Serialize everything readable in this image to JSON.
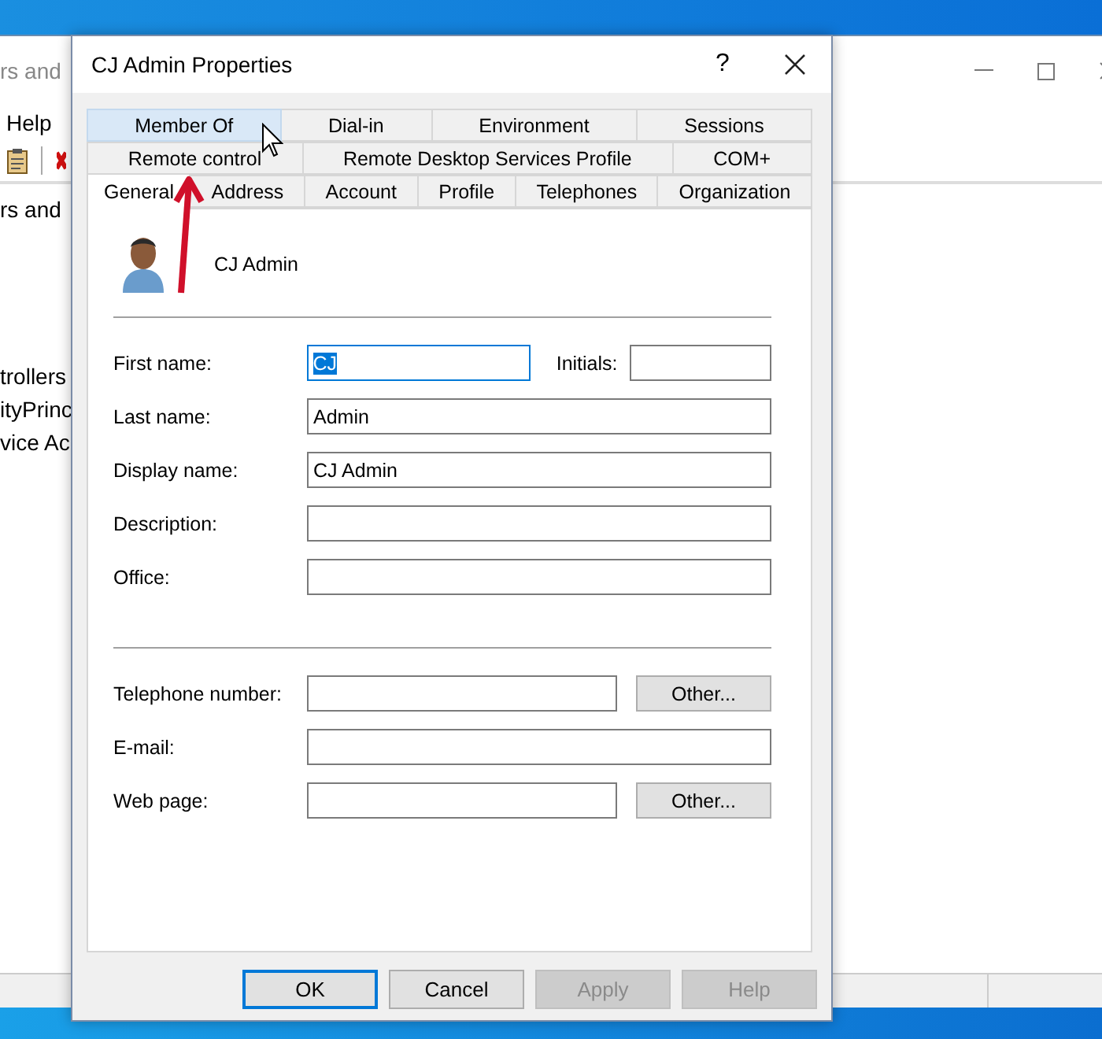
{
  "background_window": {
    "title": "rs and",
    "menu": [
      "Help"
    ],
    "tree_items": [
      {
        "label": "rs and"
      },
      {
        "label": "trollers"
      },
      {
        "label": "ityPrinc"
      },
      {
        "label": "vice Ac"
      }
    ]
  },
  "dialog": {
    "title": "CJ Admin Properties",
    "help_button": "?",
    "tab_rows": [
      [
        {
          "label": "Member Of",
          "selected": false,
          "hovered": true
        },
        {
          "label": "Dial-in",
          "selected": false,
          "hovered": false
        },
        {
          "label": "Environment",
          "selected": false,
          "hovered": false
        },
        {
          "label": "Sessions",
          "selected": false,
          "hovered": false
        }
      ],
      [
        {
          "label": "Remote control",
          "selected": false,
          "hovered": false
        },
        {
          "label": "Remote Desktop Services Profile",
          "selected": false,
          "hovered": false
        },
        {
          "label": "COM+",
          "selected": false,
          "hovered": false
        }
      ],
      [
        {
          "label": "General",
          "selected": true,
          "hovered": false
        },
        {
          "label": "Address",
          "selected": false,
          "hovered": false
        },
        {
          "label": "Account",
          "selected": false,
          "hovered": false
        },
        {
          "label": "Profile",
          "selected": false,
          "hovered": false
        },
        {
          "label": "Telephones",
          "selected": false,
          "hovered": false
        },
        {
          "label": "Organization",
          "selected": false,
          "hovered": false
        }
      ]
    ],
    "header": {
      "name": "CJ Admin"
    },
    "field_groups": [
      [
        {
          "kind": "with_initials",
          "label": "First name:",
          "value": "CJ",
          "focused": true,
          "side_label": "Initials:"
        },
        {
          "kind": "text",
          "label": "Last name:",
          "value": "Admin",
          "focused": false
        },
        {
          "kind": "text",
          "label": "Display name:",
          "value": "CJ Admin",
          "focused": false
        },
        {
          "kind": "text",
          "label": "Description:",
          "focused": false
        },
        {
          "kind": "text",
          "label": "Office:",
          "focused": false
        }
      ],
      [
        {
          "kind": "with_button",
          "label": "Telephone number:",
          "button": "Other...",
          "focused": false
        },
        {
          "kind": "text",
          "label": "E-mail:",
          "focused": false
        },
        {
          "kind": "with_button",
          "label": "Web page:",
          "button": "Other...",
          "focused": false
        }
      ]
    ],
    "buttons": [
      {
        "label": "OK",
        "default": true,
        "disabled": false
      },
      {
        "label": "Cancel",
        "default": false,
        "disabled": false
      },
      {
        "label": "Apply",
        "default": false,
        "disabled": true
      },
      {
        "label": "Help",
        "default": false,
        "disabled": true
      }
    ]
  }
}
